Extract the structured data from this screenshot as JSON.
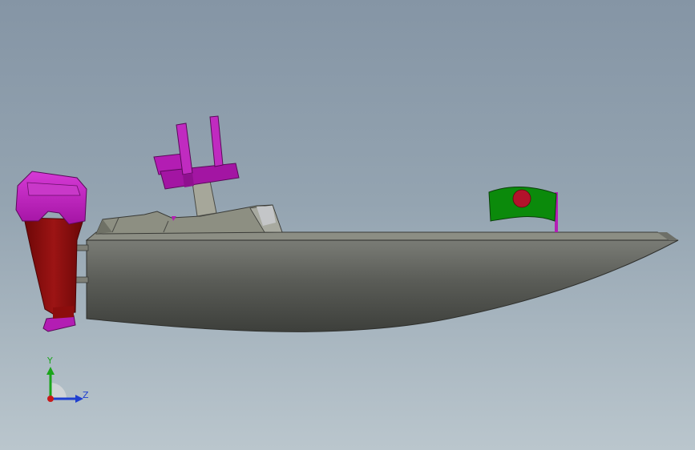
{
  "viewport": {
    "background_top": "#8595a5",
    "background_bottom": "#bac6cd"
  },
  "model": {
    "hull_color": "#565853",
    "deck_color": "#8b8d7f",
    "motor_cowl_color": "#b41eb4",
    "motor_leg_color": "#8c0d0d",
    "seat_color": "#b31db3",
    "flag_field_color": "#0b8a0b",
    "flag_disc_color": "#b3122b"
  },
  "triad": {
    "y_label": "Y",
    "z_label": "Z",
    "y_color": "#1aa51a",
    "z_color": "#1f3fd0",
    "origin_color": "#c81919"
  }
}
